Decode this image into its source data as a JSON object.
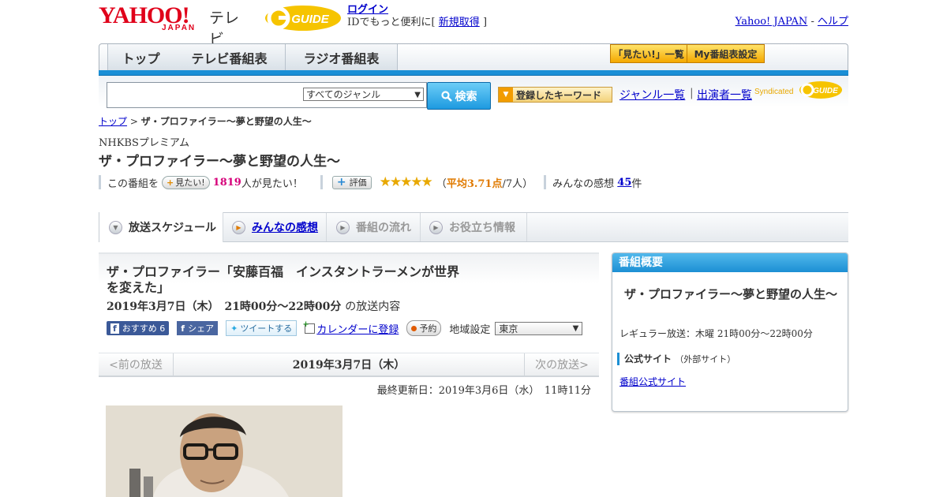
{
  "header": {
    "logo_text": "YAHOO!",
    "logo_sub": "JAPAN",
    "logo_tv": "テレビ",
    "gguide_label": "GUIDE",
    "login": "ログイン",
    "login_note_pre": "IDでもっと便利に[",
    "signup": "新規取得",
    "login_note_post": "]",
    "yahoo_japan": "Yahoo! JAPAN",
    "util_sep": "-",
    "help": "ヘルプ"
  },
  "nav": {
    "tabs": [
      "トップ",
      "テレビ番組表",
      "ラジオ番組表"
    ],
    "want_list": "「見たい!」一覧",
    "my_schedule": "My番組表設定"
  },
  "search": {
    "genre_selected": "すべてのジャンル",
    "button": "検索",
    "keyword_button": "登録したキーワード",
    "genre_list": "ジャンル一覧",
    "separator": "|",
    "cast_list": "出演者一覧",
    "syndicated": "Syndicated"
  },
  "breadcrumb": {
    "top": "トップ",
    "sep": ">",
    "current": "ザ・プロファイラー～夢と野望の人生～"
  },
  "program": {
    "channel": "NHKBSプレミアム",
    "title": "ザ・プロファイラー～夢と野望の人生～",
    "want_prefix": "この番組を",
    "want_button": "見たい!",
    "want_count": "1819",
    "want_suffix": "人が見たい！",
    "rate_button": "評価",
    "rating_stars": "★★★★★",
    "rating_open": "（",
    "rating_avg": "平均3.71点",
    "rating_count": "/7人）",
    "impressions_label": "みんなの感想",
    "impressions_count": "45",
    "impressions_suffix": "件"
  },
  "subtabs": [
    "放送スケジュール",
    "みんなの感想",
    "番組の流れ",
    "お役立ち情報"
  ],
  "episode": {
    "title": "ザ・プロファイラー「安藤百福　インスタントラーメンが世界を変えた」",
    "datetime": "2019年3月7日（木）　21時00分～22時00分",
    "datetime_suffix": "の放送内容",
    "fb_recommend": "おすすめ",
    "fb_recommend_count": "6",
    "fb_share": "シェア",
    "tweet": "ツイートする",
    "calendar": "カレンダーに登録",
    "reserve": "予約",
    "region_label": "地域設定",
    "region_value": "東京",
    "prev": "<前の放送",
    "current_date": "2019年3月7日（木）",
    "next": "次の放送>",
    "updated": "最終更新日：2019年3月6日（水）　11時11分"
  },
  "sidebar": {
    "heading": "番組概要",
    "title": "ザ・プロファイラー～夢と野望の人生～",
    "regular": "レギュラー放送：木曜 21時00分～22時00分",
    "official_label": "公式サイト",
    "official_note": "（外部サイト）",
    "official_link": "番組公式サイト"
  },
  "colors": {
    "accent_blue": "#1a8fd6",
    "pink": "#d6007a",
    "orange": "#e07a00",
    "yahoo_red": "#e0001a"
  }
}
